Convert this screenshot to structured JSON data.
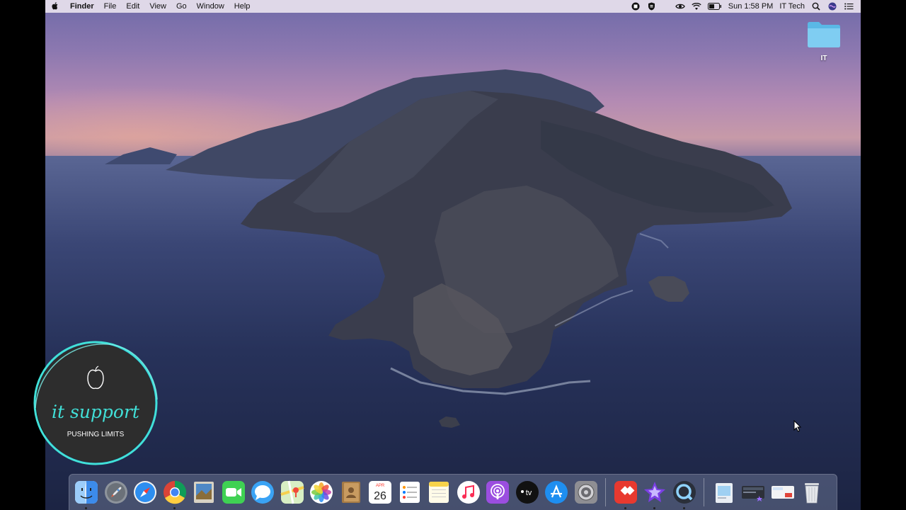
{
  "menubar": {
    "app_name": "Finder",
    "menus": [
      "File",
      "Edit",
      "View",
      "Go",
      "Window",
      "Help"
    ],
    "clock": "Sun 1:58 PM",
    "user": "IT Tech"
  },
  "desktop": {
    "folder_label": "IT"
  },
  "dock": {
    "items": [
      {
        "name": "finder",
        "running": true
      },
      {
        "name": "launchpad",
        "running": false
      },
      {
        "name": "safari",
        "running": false
      },
      {
        "name": "chrome",
        "running": true
      },
      {
        "name": "preview",
        "running": false
      },
      {
        "name": "facetime",
        "running": false
      },
      {
        "name": "messages",
        "running": false
      },
      {
        "name": "maps",
        "running": false
      },
      {
        "name": "photos",
        "running": false
      },
      {
        "name": "contacts",
        "running": false
      },
      {
        "name": "calendar",
        "running": false
      },
      {
        "name": "reminders",
        "running": false
      },
      {
        "name": "notes",
        "running": false
      },
      {
        "name": "music",
        "running": false
      },
      {
        "name": "podcasts",
        "running": false
      },
      {
        "name": "tv",
        "running": false
      },
      {
        "name": "app-store",
        "running": false
      },
      {
        "name": "system-preferences",
        "running": false
      },
      {
        "name": "anydesk",
        "running": true
      },
      {
        "name": "imovie",
        "running": true
      },
      {
        "name": "quicktime",
        "running": true
      },
      {
        "name": "downloads",
        "running": false
      },
      {
        "name": "screenshot-stack",
        "running": false
      },
      {
        "name": "documents-stack",
        "running": false
      },
      {
        "name": "trash",
        "running": false
      }
    ],
    "calendar_month": "APR",
    "calendar_day": "26",
    "tv_label": "tv"
  },
  "watermark": {
    "title": "it support",
    "subtitle": "PUSHING LIMITS"
  },
  "colors": {
    "accent_teal": "#41e0d8",
    "menubar_bg": "#e8e2ee"
  }
}
